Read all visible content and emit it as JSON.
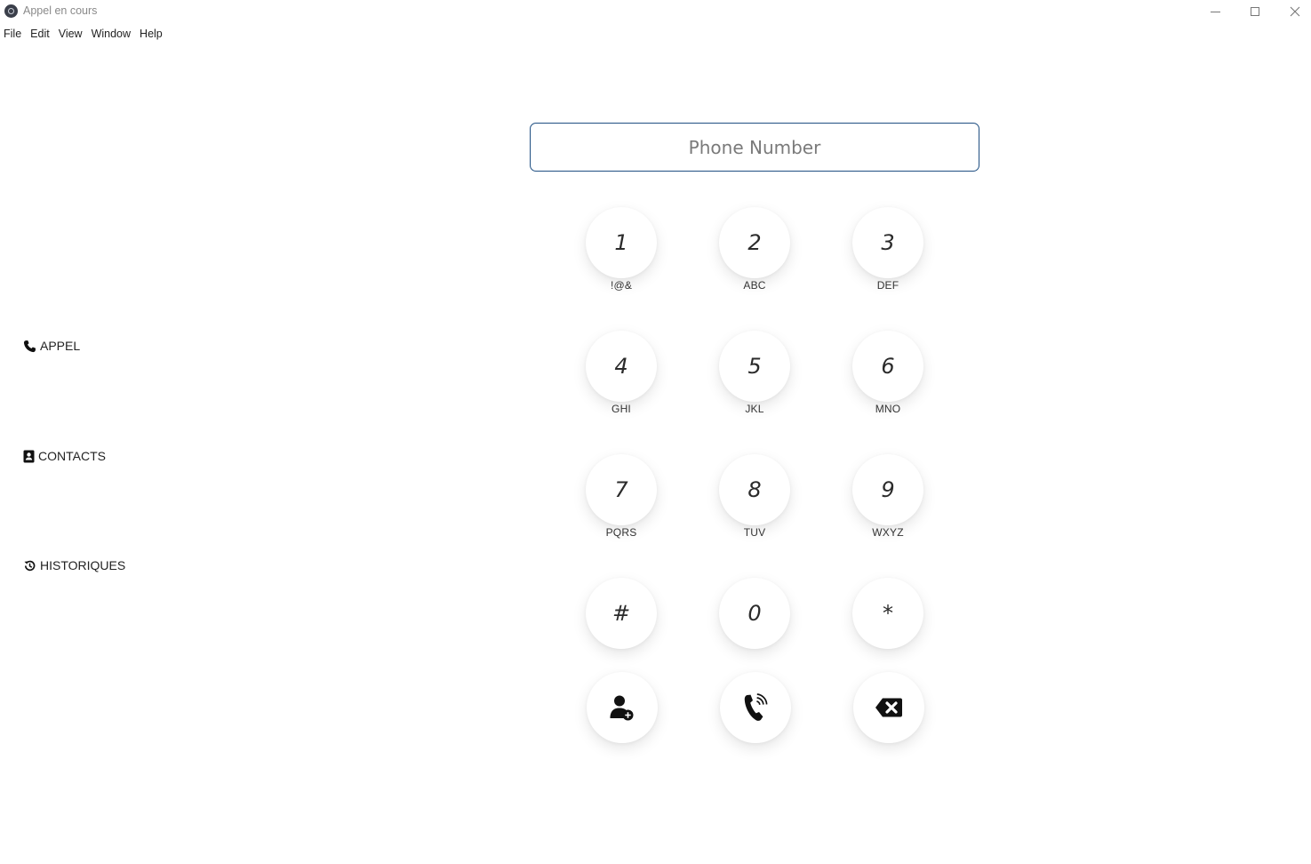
{
  "window": {
    "title": "Appel en cours"
  },
  "menu": [
    "File",
    "Edit",
    "View",
    "Window",
    "Help"
  ],
  "sidebar": {
    "items": [
      {
        "label": "APPEL",
        "icon": "phone-icon"
      },
      {
        "label": "CONTACTS",
        "icon": "address-book-icon"
      },
      {
        "label": "HISTORIQUES",
        "icon": "history-icon"
      }
    ]
  },
  "dialer": {
    "placeholder": "Phone Number",
    "value": "",
    "keys": [
      {
        "digit": "1",
        "letters": "!@&"
      },
      {
        "digit": "2",
        "letters": "ABC"
      },
      {
        "digit": "3",
        "letters": "DEF"
      },
      {
        "digit": "4",
        "letters": "GHI"
      },
      {
        "digit": "5",
        "letters": "JKL"
      },
      {
        "digit": "6",
        "letters": "MNO"
      },
      {
        "digit": "7",
        "letters": "PQRS"
      },
      {
        "digit": "8",
        "letters": "TUV"
      },
      {
        "digit": "9",
        "letters": "WXYZ"
      },
      {
        "digit": "#",
        "letters": ""
      },
      {
        "digit": "0",
        "letters": ""
      },
      {
        "digit": "*",
        "letters": ""
      }
    ],
    "actions": [
      {
        "icon": "add-contact-icon"
      },
      {
        "icon": "call-icon"
      },
      {
        "icon": "backspace-icon"
      }
    ]
  }
}
